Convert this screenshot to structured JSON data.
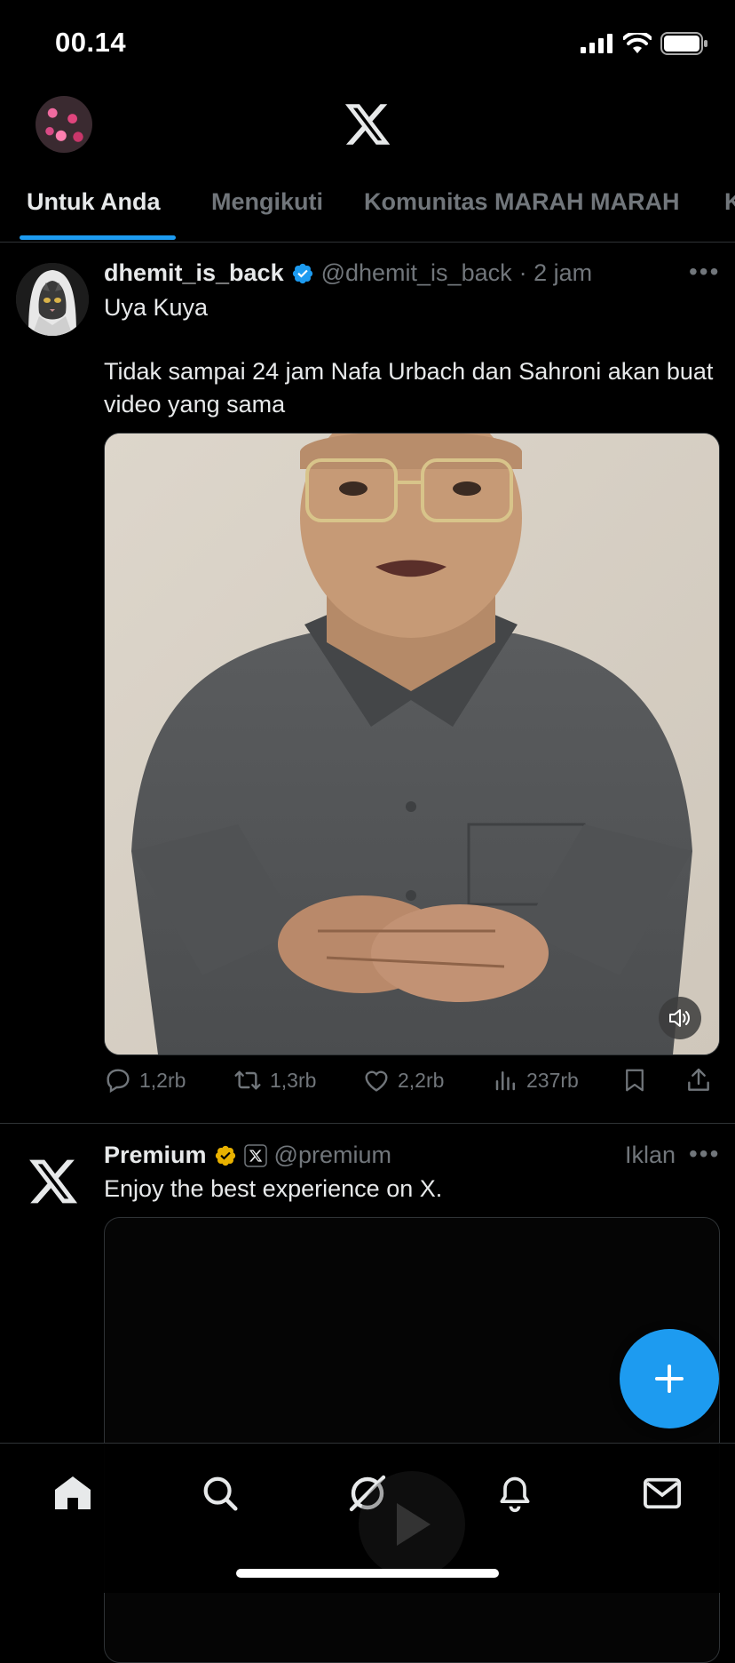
{
  "status_bar": {
    "time": "00.14"
  },
  "tabs": [
    {
      "label": "Untuk Anda",
      "active": true
    },
    {
      "label": "Mengikuti",
      "active": false
    },
    {
      "label": "Komunitas MARAH MARAH",
      "active": false
    },
    {
      "label": "K",
      "active": false
    }
  ],
  "post1": {
    "display_name": "dhemit_is_back",
    "handle": "@dhemit_is_back",
    "time": "· 2 jam",
    "text_line1": "Uya Kuya",
    "text_line2": "Tidak sampai 24 jam Nafa Urbach dan Sahroni akan buat video yang sama",
    "actions": {
      "replies": "1,2rb",
      "reposts": "1,3rb",
      "likes": "2,2rb",
      "views": "237rb"
    }
  },
  "post2": {
    "display_name": "Premium",
    "handle": "@premium",
    "ad_label": "Iklan",
    "text": "Enjoy the best experience on X."
  },
  "colors": {
    "accent": "#1d9bf0",
    "background": "#000000",
    "muted": "#71767b",
    "gold_badge": "#e8b100"
  },
  "icons": [
    "home-icon",
    "search-icon",
    "grok-icon",
    "bell-icon",
    "mail-icon",
    "compose-plus-icon",
    "verified-badge-icon",
    "more-icon",
    "volume-icon",
    "reply-icon",
    "repost-icon",
    "like-icon",
    "views-icon",
    "bookmark-icon",
    "share-icon"
  ]
}
